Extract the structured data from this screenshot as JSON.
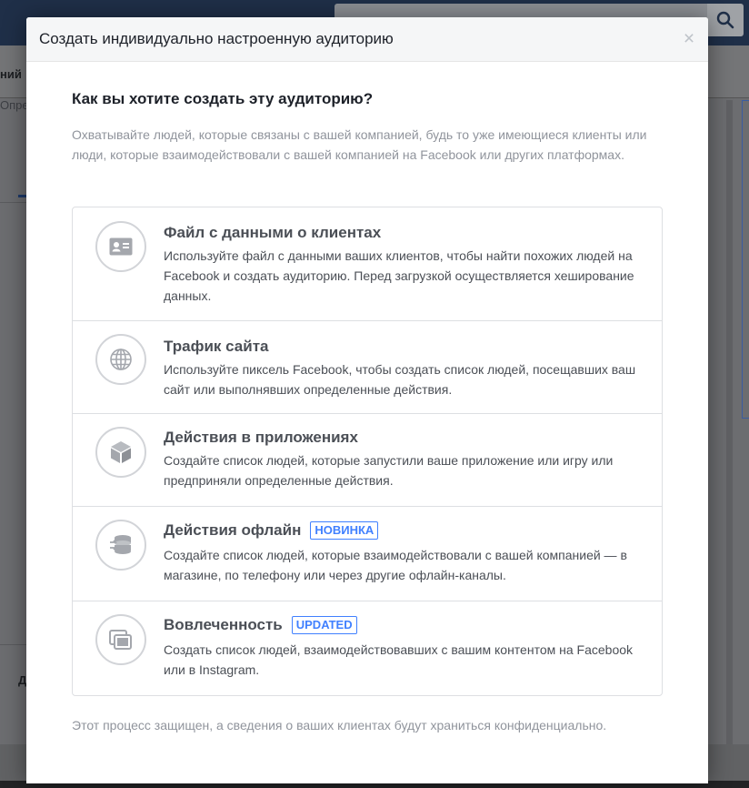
{
  "modal": {
    "title": "Создать индивидуально настроенную аудиторию",
    "close_label": "×",
    "question": "Как вы хотите создать эту аудиторию?",
    "intro": "Охватывайте людей, которые связаны с вашей компанией, будь то уже имеющиеся клиенты или люди, которые взаимодействовали с вашей компанией на Facebook или других платформах.",
    "options": [
      {
        "icon": "customer-file-icon",
        "title": "Файл с данными о клиентах",
        "badge": "",
        "description": "Используйте файл с данными ваших клиентов, чтобы найти похожих людей на Facebook и создать аудиторию. Перед загрузкой осуществляется хеширование данных."
      },
      {
        "icon": "globe-icon",
        "title": "Трафик сайта",
        "badge": "",
        "description": "Используйте пиксель Facebook, чтобы создать список людей, посещавших ваш сайт или выполнявших определенные действия."
      },
      {
        "icon": "app-cube-icon",
        "title": "Действия в приложениях",
        "badge": "",
        "description": "Создайте список людей, которые запустили ваше приложение или игру или предприняли определенные действия."
      },
      {
        "icon": "offline-sync-icon",
        "title": "Действия офлайн",
        "badge": "НОВИНКА",
        "description": "Создайте список людей, которые взаимодействовали с вашей компанией — в магазине, по телефону или через другие офлайн-каналы."
      },
      {
        "icon": "engagement-icon",
        "title": "Вовлеченность",
        "badge": "UPDATED",
        "description": "Создать список людей, взаимодействовавших с вашим контентом на Facebook или в Instagram."
      }
    ],
    "footer_note": "Этот процесс защищен, а сведения о ваших клиентах будут храниться конфиденциально."
  },
  "background": {
    "left_label_1": "ний",
    "left_label_2": "Опре",
    "left_label_3": "Д"
  },
  "colors": {
    "accent": "#4080ff",
    "topbar": "#1f2f48",
    "text_primary": "#1d2129",
    "text_secondary": "#90949c"
  }
}
